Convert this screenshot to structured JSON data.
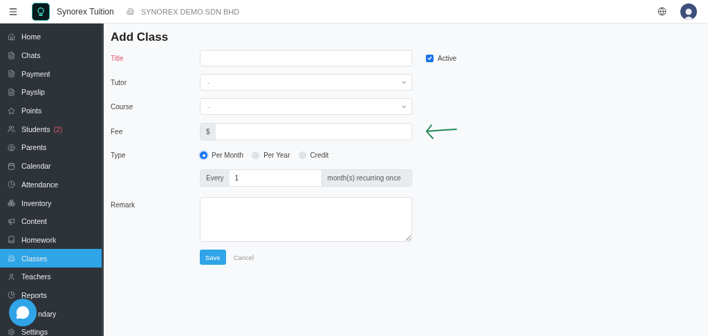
{
  "header": {
    "app_name": "Synorex Tuition",
    "company": "SYNOREX DEMO SDN BHD"
  },
  "sidebar": {
    "items": [
      {
        "label": "Home",
        "selected": false
      },
      {
        "label": "Chats",
        "selected": false
      },
      {
        "label": "Payment",
        "selected": false
      },
      {
        "label": "Payslip",
        "selected": false
      },
      {
        "label": "Points",
        "selected": false
      },
      {
        "label": "Students",
        "badge": "(2)",
        "selected": false
      },
      {
        "label": "Parents",
        "selected": false
      },
      {
        "label": "Calendar",
        "selected": false
      },
      {
        "label": "Attendance",
        "selected": false
      },
      {
        "label": "Inventory",
        "selected": false
      },
      {
        "label": "Content",
        "selected": false
      },
      {
        "label": "Homework",
        "selected": false
      },
      {
        "label": "Classes",
        "selected": true
      },
      {
        "label": "Teachers",
        "selected": false
      },
      {
        "label": "Reports",
        "selected": false
      },
      {
        "label": "ndary",
        "selected": false,
        "covered": true
      },
      {
        "label": "Settings",
        "selected": false
      }
    ]
  },
  "form": {
    "heading": "Add Class",
    "title": {
      "label": "Title",
      "required": true
    },
    "active": {
      "label": "Active",
      "checked": true
    },
    "tutor": {
      "label": "Tutor",
      "placeholder": "-"
    },
    "course": {
      "label": "Course",
      "placeholder": "-"
    },
    "fee": {
      "label": "Fee",
      "prefix": "$"
    },
    "type": {
      "label": "Type",
      "options": [
        {
          "label": "Per Month",
          "selected": true
        },
        {
          "label": "Per Year",
          "selected": false
        },
        {
          "label": "Credit",
          "selected": false
        }
      ]
    },
    "recurrence": {
      "prefix": "Every",
      "value": "1",
      "suffix": "month(s) recurring once"
    },
    "remark": {
      "label": "Remark"
    },
    "save": "Save",
    "cancel": "Cancel"
  }
}
